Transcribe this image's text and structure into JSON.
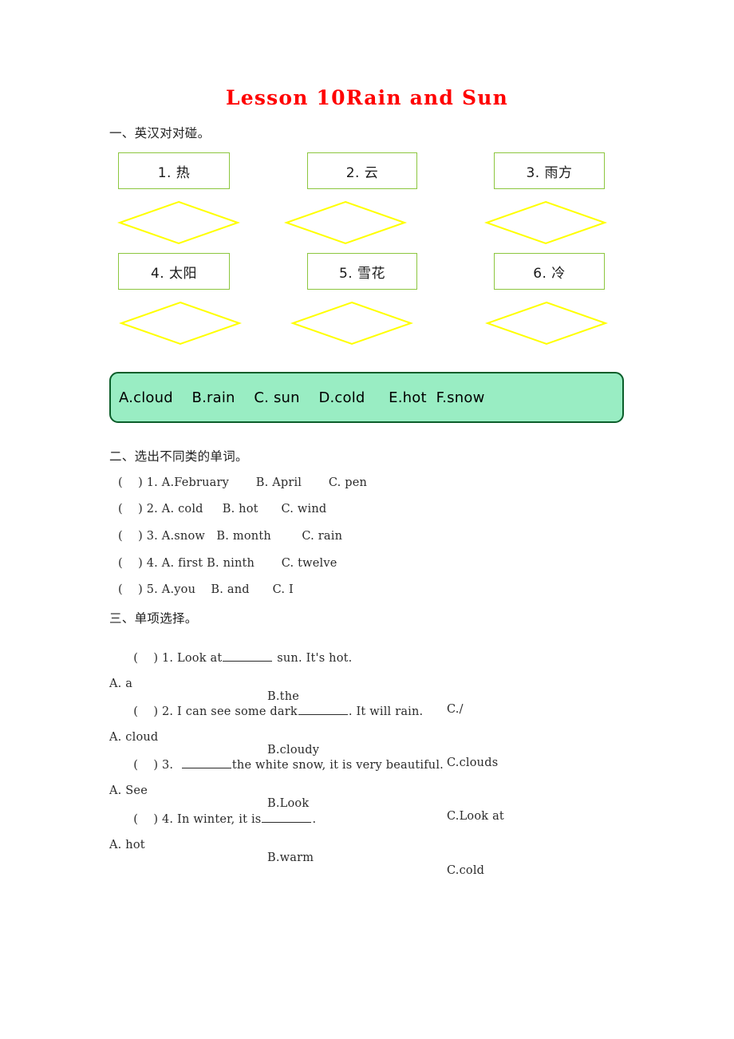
{
  "title": "Lesson 10Rain and Sun",
  "section1": {
    "heading": "一、英汉对对碰。",
    "items": [
      {
        "label": "1. 热"
      },
      {
        "label": "2. 云"
      },
      {
        "label": "3. 雨方"
      },
      {
        "label": "4. 太阳"
      },
      {
        "label": "5. 雪花"
      },
      {
        "label": "6. 冷"
      }
    ],
    "word_bank": "A.cloud    B.rain    C. sun    D.cold     E.hot  F.snow",
    "box_border_color": "#8cc63e",
    "diamond_color": "#ffff00",
    "bank_fill_color": "#99edc3",
    "bank_border_color": "#0b5e2a"
  },
  "section2": {
    "heading": "二、选出不同类的单词。",
    "questions": [
      {
        "stem": "(    ) 1. A.February       B. April       C. pen"
      },
      {
        "stem": "(    ) 2. A. cold     B. hot      C. wind"
      },
      {
        "stem": "(    ) 3. A.snow   B. month        C. rain"
      },
      {
        "stem": "(    ) 4. A. first B. ninth       C. twelve"
      },
      {
        "stem": "(    ) 5. A.you    B. and      C. I"
      }
    ]
  },
  "section3": {
    "heading": "三、单项选择。",
    "questions": [
      {
        "prefix": "(    ) 1. Look at",
        "suffix": " sun. It's hot.",
        "options": {
          "a": "A. a",
          "b": "B.the",
          "c": "C./"
        }
      },
      {
        "prefix": "(    ) 2. I can see some dark",
        "suffix": ". It will rain.",
        "options": {
          "a": "A. cloud",
          "b": "B.cloudy",
          "c": "C.clouds"
        }
      },
      {
        "prefix": "(    ) 3.  ",
        "suffix": "the white snow, it is very beautiful.",
        "options": {
          "a": "A. See",
          "b": "B.Look",
          "c": "C.Look at"
        }
      },
      {
        "prefix": "(    ) 4. In winter, it is",
        "suffix": ".",
        "options": {
          "a": "A. hot",
          "b": "B.warm",
          "c": "C.cold"
        }
      }
    ]
  }
}
